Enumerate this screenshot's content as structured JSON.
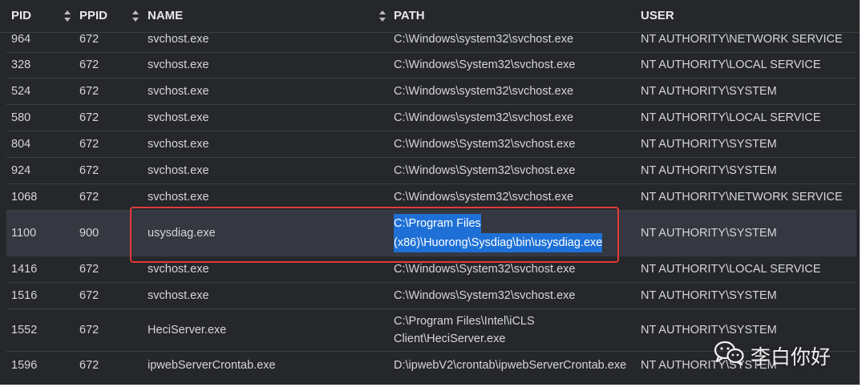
{
  "columns": [
    "PID",
    "PPID",
    "NAME",
    "PATH",
    "USER"
  ],
  "rows": [
    {
      "pid": "964",
      "ppid": "672",
      "name": "svchost.exe",
      "path": "C:\\Windows\\system32\\svchost.exe",
      "user": "NT AUTHORITY\\NETWORK SERVICE"
    },
    {
      "pid": "328",
      "ppid": "672",
      "name": "svchost.exe",
      "path": "C:\\Windows\\System32\\svchost.exe",
      "user": "NT AUTHORITY\\LOCAL SERVICE"
    },
    {
      "pid": "524",
      "ppid": "672",
      "name": "svchost.exe",
      "path": "C:\\Windows\\system32\\svchost.exe",
      "user": "NT AUTHORITY\\SYSTEM"
    },
    {
      "pid": "580",
      "ppid": "672",
      "name": "svchost.exe",
      "path": "C:\\Windows\\system32\\svchost.exe",
      "user": "NT AUTHORITY\\LOCAL SERVICE"
    },
    {
      "pid": "804",
      "ppid": "672",
      "name": "svchost.exe",
      "path": "C:\\Windows\\System32\\svchost.exe",
      "user": "NT AUTHORITY\\SYSTEM"
    },
    {
      "pid": "924",
      "ppid": "672",
      "name": "svchost.exe",
      "path": "C:\\Windows\\System32\\svchost.exe",
      "user": "NT AUTHORITY\\SYSTEM"
    },
    {
      "pid": "1068",
      "ppid": "672",
      "name": "svchost.exe",
      "path": "C:\\Windows\\system32\\svchost.exe",
      "user": "NT AUTHORITY\\NETWORK SERVICE"
    },
    {
      "pid": "1100",
      "ppid": "900",
      "name": "usysdiag.exe",
      "path_line1": "C:\\Program Files",
      "path_line2": "(x86)\\Huorong\\Sysdiag\\bin\\usysdiag.exe",
      "user": "NT AUTHORITY\\SYSTEM"
    },
    {
      "pid": "1416",
      "ppid": "672",
      "name": "svchost.exe",
      "path": "C:\\Windows\\System32\\svchost.exe",
      "user": "NT AUTHORITY\\LOCAL SERVICE"
    },
    {
      "pid": "1516",
      "ppid": "672",
      "name": "svchost.exe",
      "path": "C:\\Windows\\System32\\svchost.exe",
      "user": "NT AUTHORITY\\SYSTEM"
    },
    {
      "pid": "1552",
      "ppid": "672",
      "name": "HeciServer.exe",
      "path_line1": "C:\\Program Files\\Intel\\iCLS",
      "path_line2": "Client\\HeciServer.exe",
      "user": "NT AUTHORITY\\SYSTEM"
    },
    {
      "pid": "1596",
      "ppid": "672",
      "name": "ipwebServerCrontab.exe",
      "path": "D:\\ipwebV2\\crontab\\ipwebServerCrontab.exe",
      "user": "NT AUTHORITY\\SYSTEM"
    }
  ],
  "watermark": "李白你好",
  "icons": {
    "sort": "sort-arrows-icon",
    "watermark": "wechat-icon"
  },
  "colors": {
    "background": "#25272b",
    "selection": "#1e70d6",
    "annotation": "#e03a3a"
  }
}
